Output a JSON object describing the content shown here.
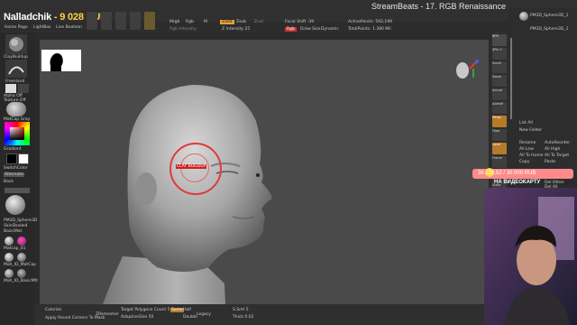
{
  "overlay": {
    "title": "Nalladchik",
    "price": "- 9 028 RUB"
  },
  "stream": {
    "title": "StreamBeats - 17. RGB Renaissance"
  },
  "top_tabs": [
    "Home Page",
    "LightBox",
    "Live Boolean"
  ],
  "toolbar": {
    "mrgb": "Mrgb",
    "rgb": "Rgb",
    "m": "M",
    "zadd": "Zadd",
    "zsub": "Zsub",
    "zcut": "Zcut",
    "rgb_intensity": "Rgb Intensity",
    "z_intensity": "Z Intensity 25",
    "focal_shift": "Focal Shift -39",
    "draw_size": "Draw Size",
    "dynamic": "Dynamic",
    "active_points": "ActivePoints: 592,199",
    "total_points": "TotalPoints: 1.380 Mil"
  },
  "left_tray": {
    "brush": "ClayBuildup",
    "stroke": "FreeHand",
    "alpha": "Alpha Off",
    "texture": "Texture Off",
    "material": "MatCap Gray",
    "gradient": "Gradient",
    "switch_color": "SwitchColor",
    "alternate": "Alternate",
    "back": "Back",
    "spheres": [
      "PM3D_Sphere3D",
      "SkinShade4",
      "BasicMat"
    ],
    "materials": [
      "Matcap_01",
      "Mah_ID_MatCap",
      "Mah_ID_BasicMtl",
      "Mah_ID_BasicMtl",
      "Mah_ID_BasicMtl"
    ]
  },
  "right_tray": {
    "buttons": [
      "BPR",
      "SPix 3",
      "Scroll",
      "Zoom",
      "Actual",
      "AAHalf",
      "Persp",
      "Floor",
      "Local",
      "Frame",
      "Move",
      "Scale",
      "Rotate",
      "Transp",
      "Solo",
      "Dynamic"
    ]
  },
  "subtool": {
    "items": [
      "PM3D_Sphere3D_1",
      "PM3D_Sphere3D_1"
    ],
    "buttons": [
      "List All",
      "New Folder",
      "Rename",
      "AutoReorder",
      "All Low",
      "All High",
      "All To Home",
      "All To Target",
      "Copy",
      "Paste"
    ],
    "bottom": [
      "Del Other",
      "Del All"
    ]
  },
  "bottom": {
    "colorize": "Colorize",
    "apply": "Apply Round Corners To Mask",
    "zremesher": "ZRemesher",
    "target": "Target Polygons Count 5",
    "adaptive": "AdaptiveSize 50",
    "same": "Same",
    "half": "Half",
    "double": "Double",
    "legacy": "Legacy",
    "smt": "S.Smt 5",
    "thick": "Thick 0.02"
  },
  "viewport": {
    "cursor_label": "CLAY BUILDUP"
  },
  "donation": {
    "text": "36 229.52 / 30 000 RUB",
    "label": "НА ВИДЕОКАРТУ"
  },
  "colors": {
    "accent": "#e8a33a",
    "draw_ring": "#e03a3a",
    "goal_bar": "#ff8a8a"
  }
}
